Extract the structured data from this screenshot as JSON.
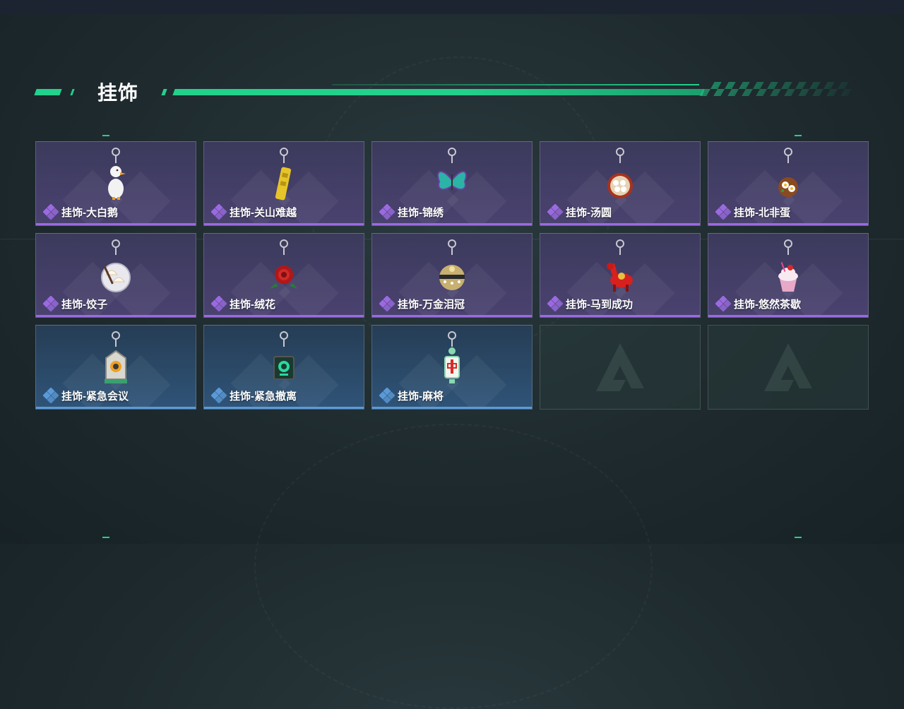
{
  "header": {
    "title": "挂饰"
  },
  "items": [
    {
      "label": "挂饰-大白鹅",
      "rarity": "purple",
      "icon": "goose-charm-icon"
    },
    {
      "label": "挂饰-关山难越",
      "rarity": "purple",
      "icon": "gold-bar-charm-icon"
    },
    {
      "label": "挂饰-锦绣",
      "rarity": "purple",
      "icon": "butterfly-charm-icon"
    },
    {
      "label": "挂饰-汤圆",
      "rarity": "purple",
      "icon": "tangyuan-bowl-charm-icon"
    },
    {
      "label": "挂饰-北非蛋",
      "rarity": "purple",
      "icon": "shakshuka-charm-icon"
    },
    {
      "label": "挂饰-饺子",
      "rarity": "purple",
      "icon": "dumpling-plate-charm-icon"
    },
    {
      "label": "挂饰-绒花",
      "rarity": "purple",
      "icon": "red-flower-charm-icon"
    },
    {
      "label": "挂饰-万金泪冠",
      "rarity": "purple",
      "icon": "crown-charm-icon"
    },
    {
      "label": "挂饰-马到成功",
      "rarity": "purple",
      "icon": "red-horse-charm-icon"
    },
    {
      "label": "挂饰-悠然茶歇",
      "rarity": "purple",
      "icon": "cupcake-charm-icon"
    },
    {
      "label": "挂饰-紧急会议",
      "rarity": "blue",
      "icon": "emergency-meeting-charm-icon"
    },
    {
      "label": "挂饰-紧急撤离",
      "rarity": "blue",
      "icon": "emergency-evac-charm-icon"
    },
    {
      "label": "挂饰-麻将",
      "rarity": "blue",
      "icon": "mahjong-tile-charm-icon"
    }
  ],
  "empty_slots": [
    {
      "icon": "game-logo-icon"
    },
    {
      "icon": "game-logo-icon"
    }
  ],
  "colors": {
    "accent": "#22d18b",
    "purple_rarity": "#9b6ae0",
    "blue_rarity": "#5b9ad8"
  }
}
